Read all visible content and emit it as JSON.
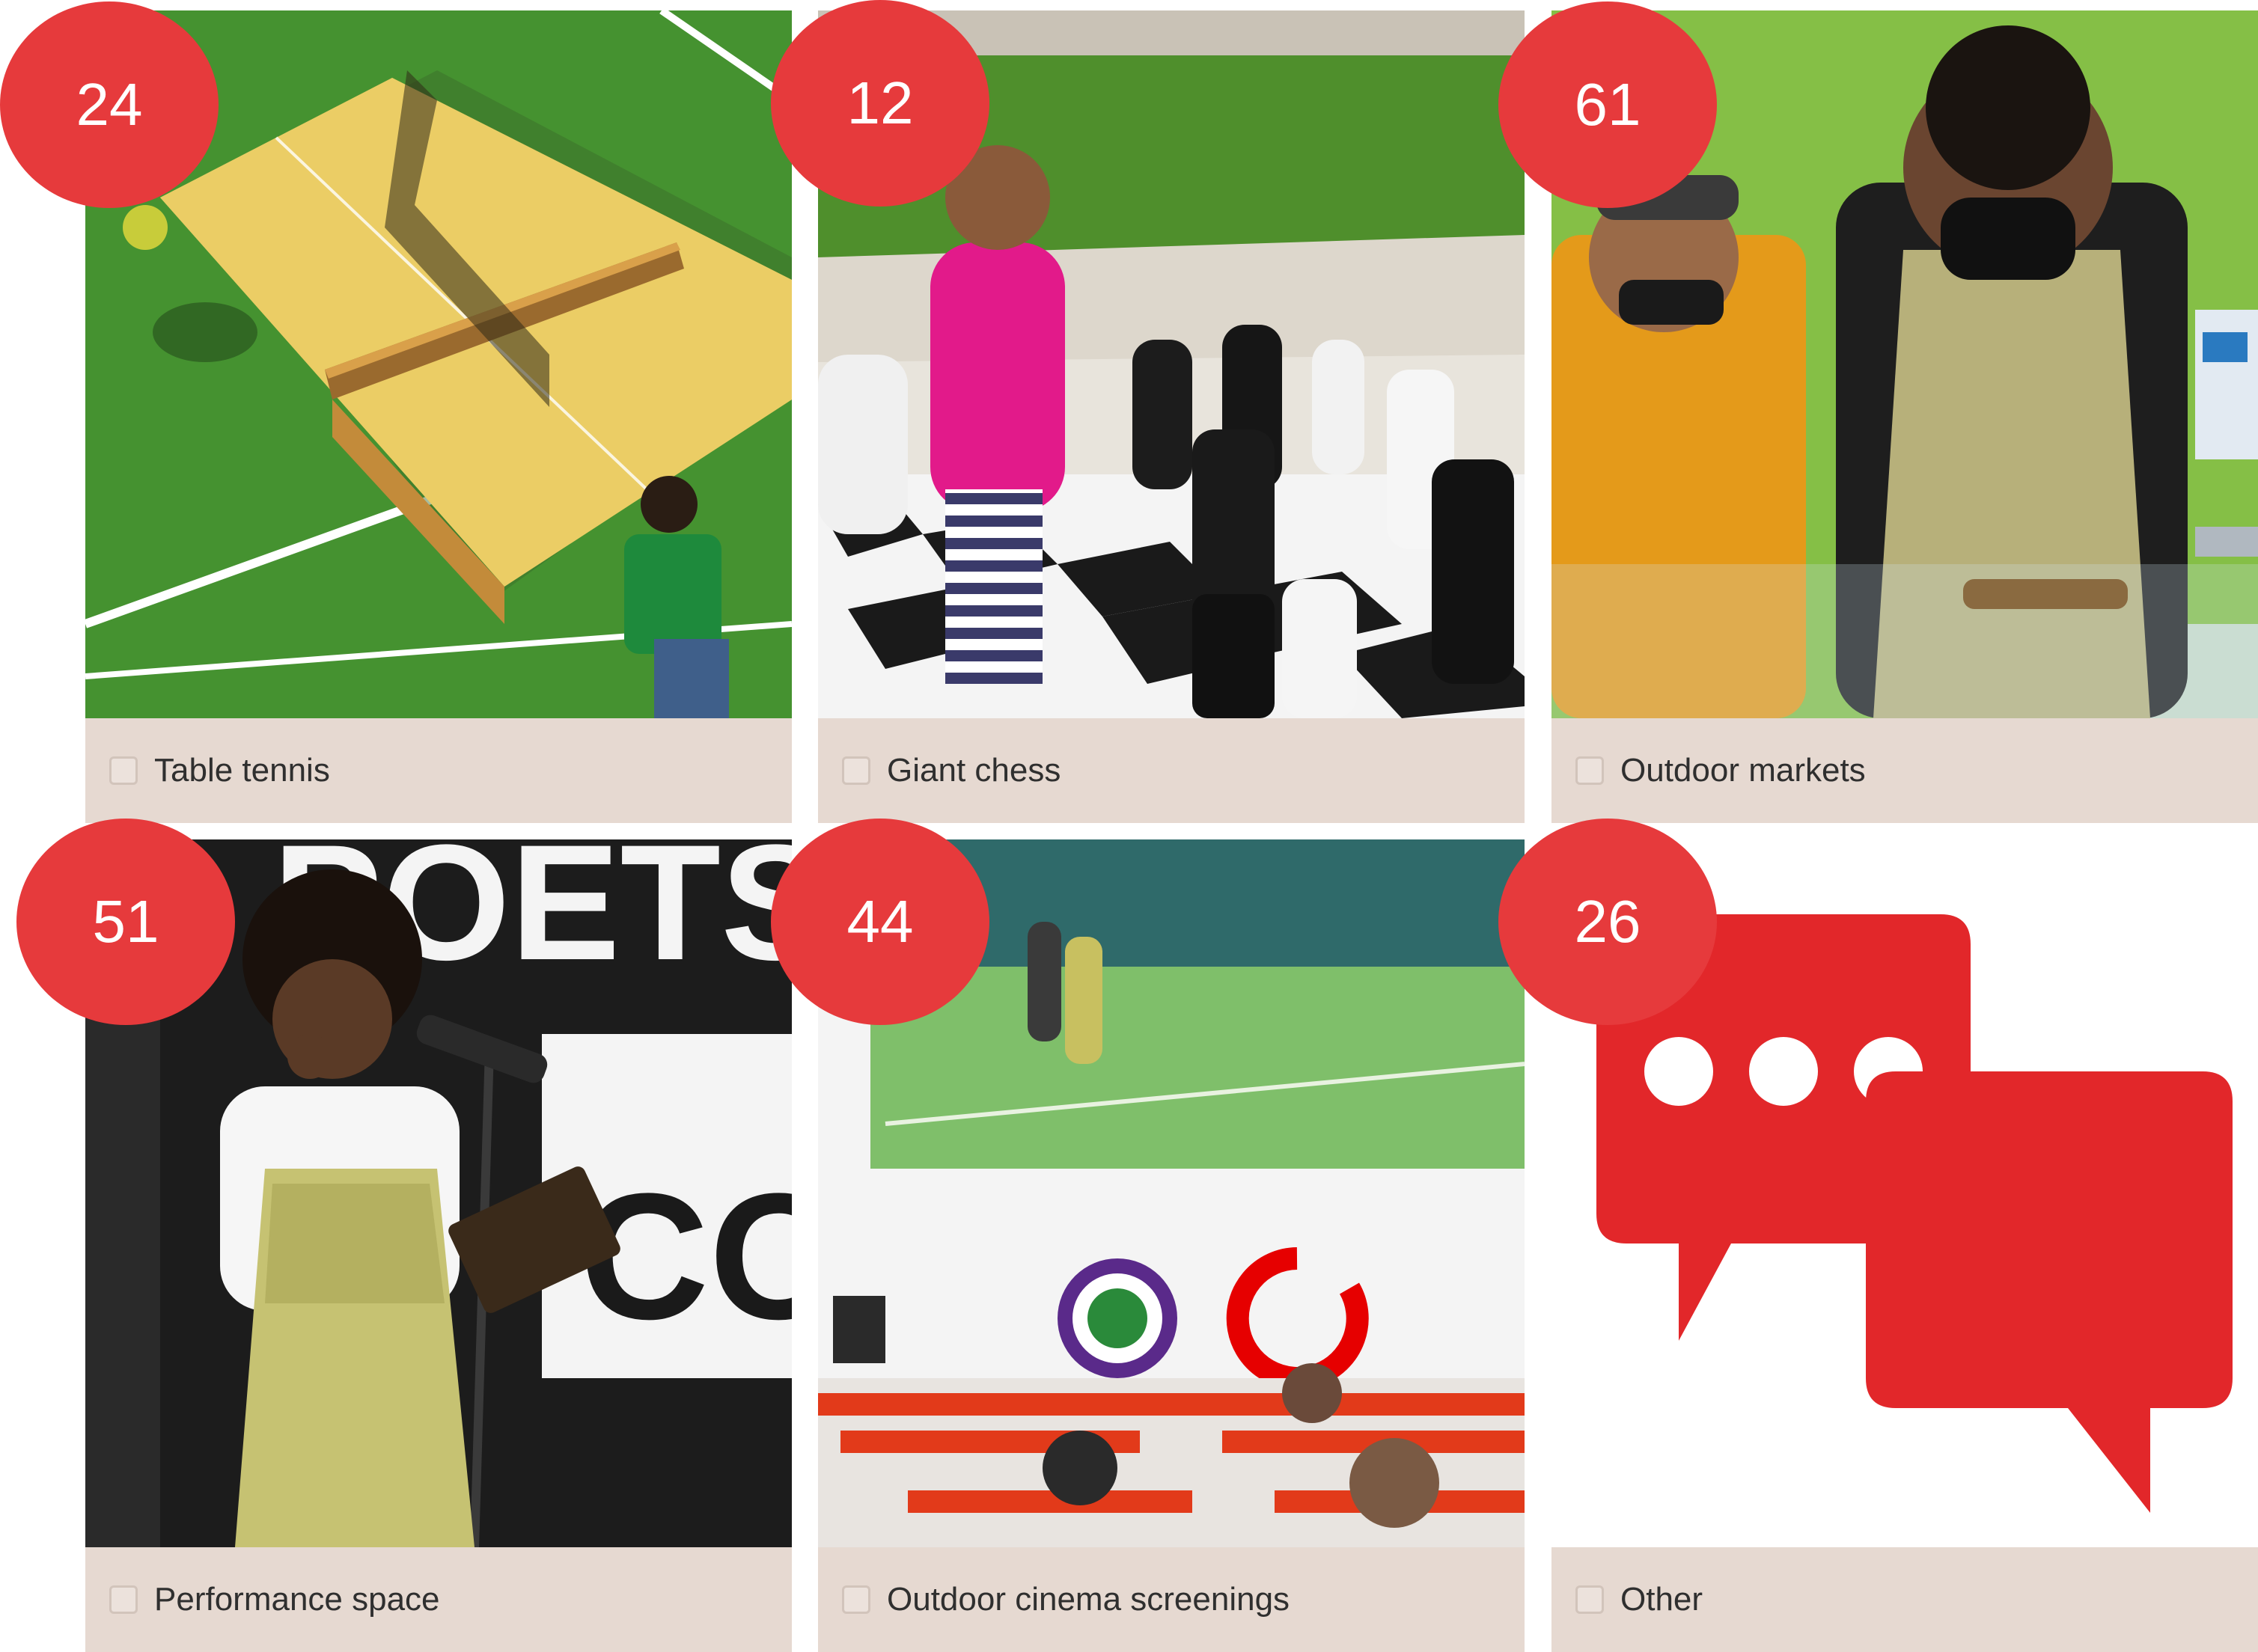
{
  "colors": {
    "badge": "#e63a3c",
    "card_footer": "#e6d9d1",
    "checkbox_border": "#d2c4bb",
    "label_text": "#2f2f2f"
  },
  "options": [
    {
      "label": "Table tennis",
      "count": "24",
      "image": "table-tennis-photo",
      "checked": false
    },
    {
      "label": "Giant chess",
      "count": "12",
      "image": "giant-chess-photo",
      "checked": false
    },
    {
      "label": "Outdoor markets",
      "count": "61",
      "image": "outdoor-market-photo",
      "checked": false
    },
    {
      "label": "Performance space",
      "count": "51",
      "image": "poetry-performance-photo",
      "checked": false
    },
    {
      "label": "Outdoor cinema screenings",
      "count": "44",
      "image": "outdoor-cinema-photo",
      "checked": false
    },
    {
      "label": "Other",
      "count": "26",
      "image": "speech-bubbles-icon",
      "checked": false
    }
  ],
  "photo_text": {
    "poets_sign_1": "POETS'",
    "poets_sign_2": "CO"
  }
}
